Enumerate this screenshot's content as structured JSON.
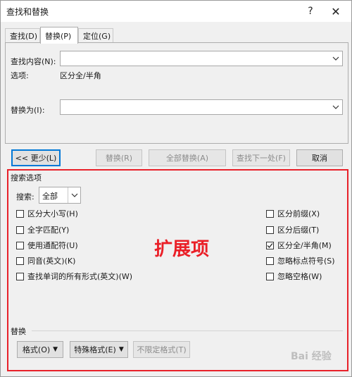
{
  "window": {
    "title": "查找和替换",
    "help": "?",
    "close": "✕"
  },
  "tabs": [
    {
      "label": "查找(D)"
    },
    {
      "label": "替换(P)"
    },
    {
      "label": "定位(G)"
    }
  ],
  "find": {
    "label": "查找内容(N):",
    "value": "",
    "options_label": "选项:",
    "options_value": "区分全/半角"
  },
  "replace": {
    "label": "替换为(I):",
    "value": ""
  },
  "buttons": {
    "less": "<< 更少(L)",
    "replace": "替换(R)",
    "replace_all": "全部替换(A)",
    "find_next": "查找下一处(F)",
    "cancel": "取消"
  },
  "search_options": {
    "title": "搜索选项",
    "search_label": "搜索:",
    "search_value": "全部",
    "left": [
      {
        "label": "区分大小写(H)",
        "checked": false
      },
      {
        "label": "全字匹配(Y)",
        "checked": false
      },
      {
        "label": "使用通配符(U)",
        "checked": false
      },
      {
        "label": "同音(英文)(K)",
        "checked": false
      },
      {
        "label": "查找单词的所有形式(英文)(W)",
        "checked": false
      }
    ],
    "right": [
      {
        "label": "区分前缀(X)",
        "checked": false
      },
      {
        "label": "区分后缀(T)",
        "checked": false
      },
      {
        "label": "区分全/半角(M)",
        "checked": true
      },
      {
        "label": "忽略标点符号(S)",
        "checked": false
      },
      {
        "label": "忽略空格(W)",
        "checked": false
      }
    ]
  },
  "annotation": {
    "text": "扩展项",
    "color": "#e8212a"
  },
  "replace_section": {
    "title": "替换",
    "format": "格式(O)",
    "special": "特殊格式(E)",
    "no_format": "不限定格式(T)"
  },
  "watermark": "Bai 经验"
}
